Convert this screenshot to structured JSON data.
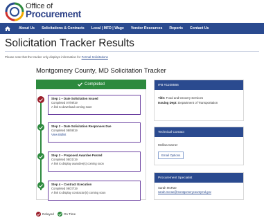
{
  "brand": {
    "line1": "Office of",
    "line2": "Procurement"
  },
  "nav": {
    "items": [
      "About Us",
      "Solicitations & Contracts",
      "Local | MFD | Wage",
      "Vendor Resources",
      "Reports",
      "Contact Us"
    ]
  },
  "page": {
    "title": "Solicitation Tracker Results",
    "note_prefix": "Please note that the tracker only displays information for ",
    "note_link": "Formal Solicitations"
  },
  "tracker": {
    "title": "Montgomery County, MD Solicitation Tracker",
    "status": "Completed",
    "steps": [
      {
        "title": "Step 1 – Date Solicitation Issued",
        "date": "Completed 07/09/19",
        "detail": "A link to download coming soon",
        "detail_is_link": false,
        "marker": "delayed"
      },
      {
        "title": "Step 2 – Date Solicitation Responses Due",
        "date": "Completed 08/08/19",
        "detail": "View Bidlist",
        "detail_is_link": true,
        "marker": "on-time"
      },
      {
        "title": "Step 3 – Proposed Awardee Posted",
        "date": "Completed 08/21/19",
        "detail": "A link to display awardee(s) coming soon",
        "detail_is_link": false,
        "marker": "on-time"
      },
      {
        "title": "Step 4 – Contract Execution",
        "date": "Completed 09/27/19",
        "detail": "A link to display contractor(s) coming soon",
        "detail_is_link": false,
        "marker": "on-time"
      }
    ],
    "legend": {
      "delayed": "Delayed",
      "on_time": "On Time"
    }
  },
  "ifb": {
    "header": "IFB #1108566",
    "title_label": "Title:",
    "title_value": "Food and Grocery Services",
    "dept_label": "Issuing Dept:",
    "dept_value": "Department of Transportation"
  },
  "technical_contact": {
    "header": "Technical Contact",
    "name": "Mellisa Garner",
    "button": "Email Options"
  },
  "procurement_specialist": {
    "header": "Procurement Specialist",
    "name": "Sarah McRae",
    "email": "sarah.mcrae@montgomerycountymd.gov"
  },
  "colors": {
    "nav": "#2a4a8f",
    "completed": "#2d8a3e",
    "delayed": "#9b1d2a",
    "step_border": "#6a3fa0"
  }
}
